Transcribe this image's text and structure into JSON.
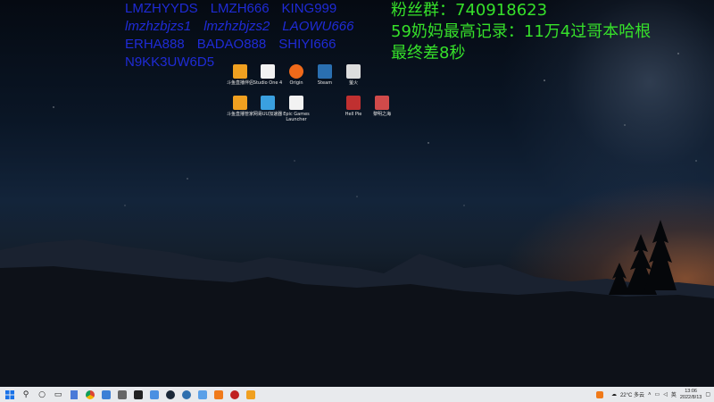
{
  "overlay": {
    "blue_rows": [
      [
        "LMZHYYDS",
        "LMZH666",
        "KING999"
      ],
      [
        "lmzhzbjzs1",
        "lmzhzbjzs2",
        "LAOWU666"
      ],
      [
        "ERHA888",
        "BADAO888",
        "SHIYI666"
      ],
      [
        "N9KK3UW6D5"
      ]
    ],
    "green_lines": [
      "粉丝群：740918623",
      "59奶妈最高记录：11万4过哥本哈根",
      "最终差8秒"
    ]
  },
  "desktop_icons": [
    {
      "label": "斗鱼直播伴侣",
      "color": "#f0a020"
    },
    {
      "label": "Studio One 4",
      "color": "#ffffff"
    },
    {
      "label": "Origin",
      "color": "#f06a1a"
    },
    {
      "label": "Steam",
      "color": "#2a6fb0"
    },
    {
      "label": "萤火",
      "color": "#dddddd"
    },
    {
      "label": "斗鱼直播管家",
      "color": "#f0a020"
    },
    {
      "label": "网易UU加速器",
      "color": "#3aa0e0"
    },
    {
      "label": "Epic Games Launcher",
      "color": "#ffffff"
    },
    {
      "label": "Hell Pie",
      "color": "#c03030"
    },
    {
      "label": "黎明之海",
      "color": "#d04a4a"
    }
  ],
  "taskbar": {
    "start_icon": "windows-logo-icon",
    "apps": [
      "search-icon",
      "cortana-icon",
      "task-view-icon",
      "notepad-icon",
      "chrome-icon",
      "app-icon",
      "app-icon",
      "app-icon",
      "app-icon",
      "steam-icon",
      "app-icon",
      "app-icon",
      "app-icon",
      "app-icon"
    ],
    "weather": "22°C 多云",
    "time": "13:06",
    "date": "2022/8/13"
  }
}
